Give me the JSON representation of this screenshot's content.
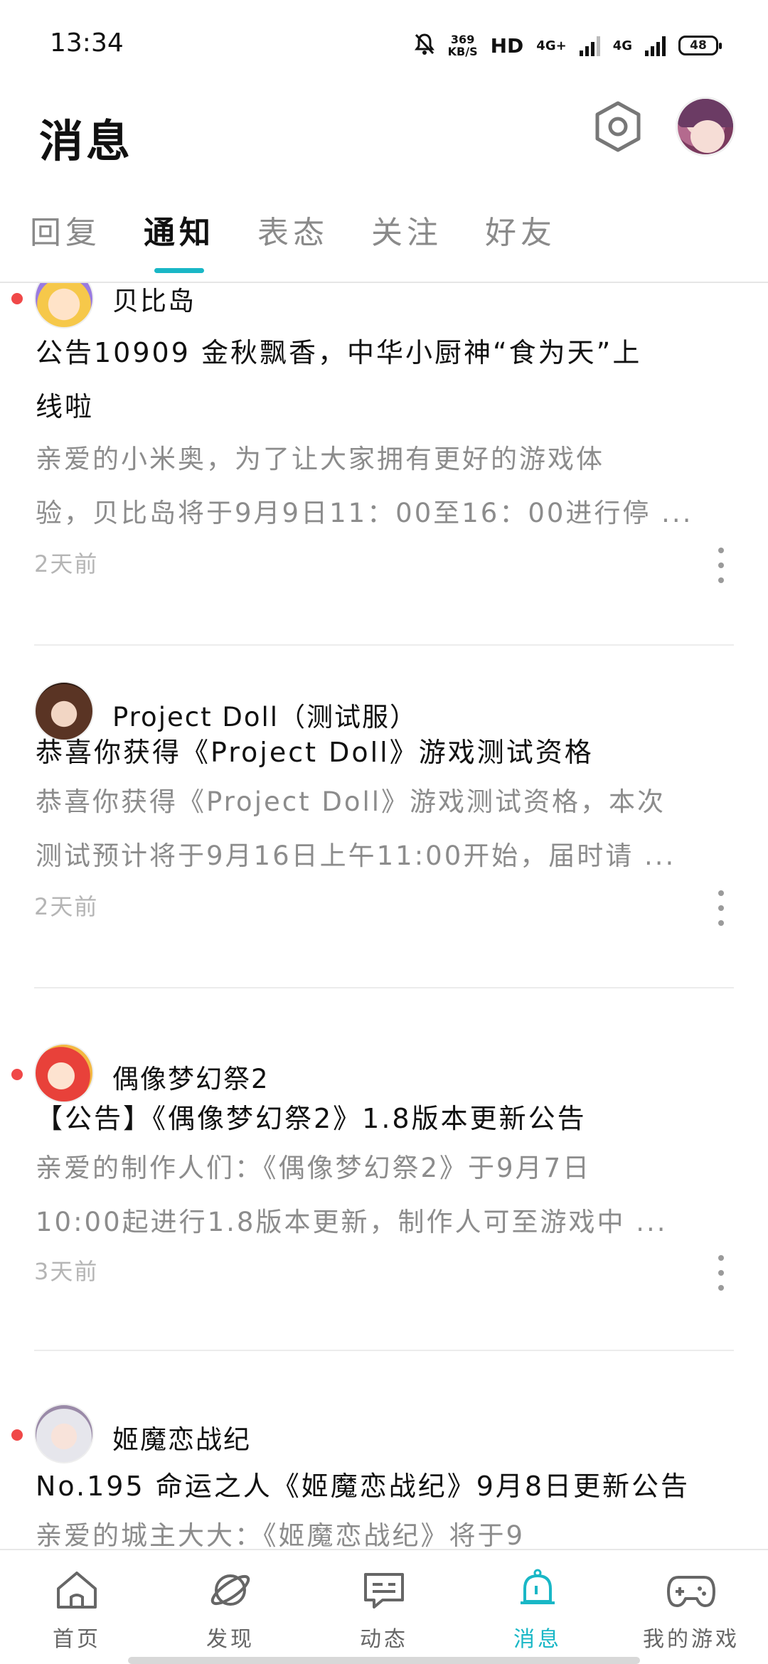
{
  "status_bar": {
    "time": "13:34",
    "speed_value": "369",
    "speed_unit": "KB/S",
    "hd_label": "HD",
    "net1": "4G+",
    "net2": "4G",
    "battery": "48"
  },
  "header": {
    "title": "消息",
    "settings_icon": "settings-hexagon-icon"
  },
  "tabs": [
    {
      "label": "回复",
      "active": false
    },
    {
      "label": "通知",
      "active": true
    },
    {
      "label": "表态",
      "active": false
    },
    {
      "label": "关注",
      "active": false
    },
    {
      "label": "好友",
      "active": false
    }
  ],
  "notifications": [
    {
      "game": "贝比岛",
      "unread": true,
      "title_line1": "公告10909 金秋飘香，中华小厨神“食为天”上",
      "title_line2": "线啦",
      "desc_line1": "亲爱的小米奥，为了让大家拥有更好的游戏体",
      "desc_line2": "验，贝比岛将于9月9日11：00至16：00进行停 ...",
      "time": "2天前"
    },
    {
      "game": "Project Doll（测试服）",
      "unread": false,
      "title_line1": "恭喜你获得《Project Doll》游戏测试资格",
      "desc_line1": "恭喜你获得《Project Doll》游戏测试资格，本次",
      "desc_line2": "测试预计将于9月16日上午11:00开始，届时请 ...",
      "time": "2天前"
    },
    {
      "game": "偶像梦幻祭2",
      "unread": true,
      "title_line1": "【公告】《偶像梦幻祭2》1.8版本更新公告",
      "desc_line1": "亲爱的制作人们：《偶像梦幻祭2》于9月7日",
      "desc_line2": "10:00起进行1.8版本更新，制作人可至游戏中 ...",
      "time": "3天前"
    },
    {
      "game": "姬魔恋战纪",
      "unread": true,
      "title_line1": "No.195 命运之人《姬魔恋战纪》9月8日更新公告",
      "desc_line1": "亲爱的城主大大：《姬魔恋战纪》将于9"
    }
  ],
  "bottom_nav": [
    {
      "label": "首页",
      "icon": "home-icon",
      "active": false
    },
    {
      "label": "发现",
      "icon": "planet-icon",
      "active": false
    },
    {
      "label": "动态",
      "icon": "chat-bubble-icon",
      "active": false
    },
    {
      "label": "消息",
      "icon": "bell-icon",
      "active": true
    },
    {
      "label": "我的游戏",
      "icon": "gamepad-icon",
      "active": false
    }
  ],
  "colors": {
    "accent": "#19b7c6",
    "unread": "#f04848",
    "secondary_text": "#8c8c8c"
  }
}
